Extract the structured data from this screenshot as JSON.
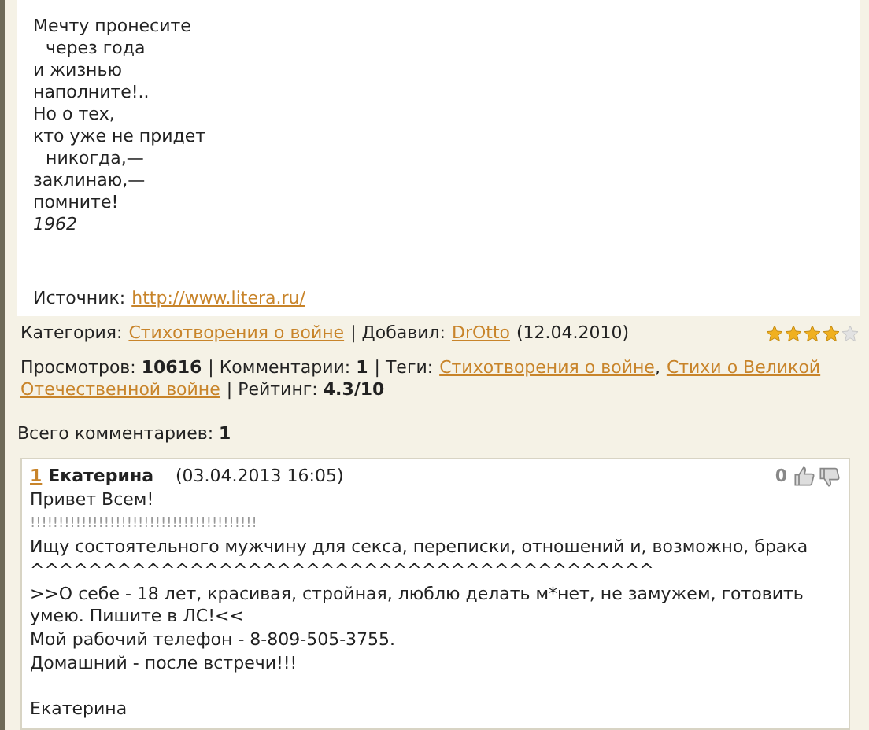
{
  "poem": {
    "lines": [
      {
        "text": "Мечту пронесите",
        "indent": false
      },
      {
        "text": "через года",
        "indent": true
      },
      {
        "text": "и жизнью",
        "indent": false
      },
      {
        "text": "наполните!..",
        "indent": false
      },
      {
        "text": "Но о тех,",
        "indent": false
      },
      {
        "text": "кто уже не придет",
        "indent": false
      },
      {
        "text": "никогда,—",
        "indent": true
      },
      {
        "text": "заклинаю,—",
        "indent": false
      },
      {
        "text": "помните!",
        "indent": false
      }
    ],
    "year": "1962",
    "source_label": "Источник:",
    "source_link": "http://www.litera.ru/"
  },
  "meta": {
    "category_label": "Категория:",
    "category": "Стихотворения о войне",
    "added_label": "| Добавил:",
    "author": "DrOtto",
    "date": "(12.04.2010)",
    "stars": 4,
    "views_label": "Просмотров:",
    "views": "10616",
    "comments_label": "| Комментарии:",
    "comments": "1",
    "tags_label": "| Теги:",
    "tags": [
      {
        "parts": [
          "Стихотворения о войне"
        ]
      },
      {
        "parts": [
          "Стихи о Великой",
          "Отечественной войне"
        ]
      }
    ],
    "tag_separator": ",",
    "rating_label": "| Рейтинг:",
    "rating": "4.3/10"
  },
  "total_label": "Всего комментариев:",
  "total": "1",
  "comment": {
    "number": "1",
    "author": "Екатерина",
    "date": "(03.04.2013 16:05)",
    "score": "0",
    "lines": [
      {
        "text": "Привет Всем!",
        "kind": "text"
      },
      {
        "text": "!!!!!!!!!!!!!!!!!!!!!!!!!!!!!!!!!!!!!!!!",
        "kind": "marks"
      },
      {
        "text": "Ищу состоятельного мужчину для секса, переписки, отношений и, возможно, брака",
        "kind": "text"
      },
      {
        "text": "^^^^^^^^^^^^^^^^^^^^^^^^^^^^^^^^^^^^^^^^^^^",
        "kind": "text"
      },
      {
        "text": ">>О себе - 18 лет, красивая, стройная, люблю делать м*нет, не замужем, готовить умею. Пишите в ЛС!<<",
        "kind": "text"
      },
      {
        "text": "Мой рабочий телефон - 8-809-505-3755.",
        "kind": "text"
      },
      {
        "text": "Домашний - после встречи!!!",
        "kind": "text"
      },
      {
        "kind": "blank"
      },
      {
        "text": "Екатерина",
        "kind": "text"
      }
    ]
  }
}
